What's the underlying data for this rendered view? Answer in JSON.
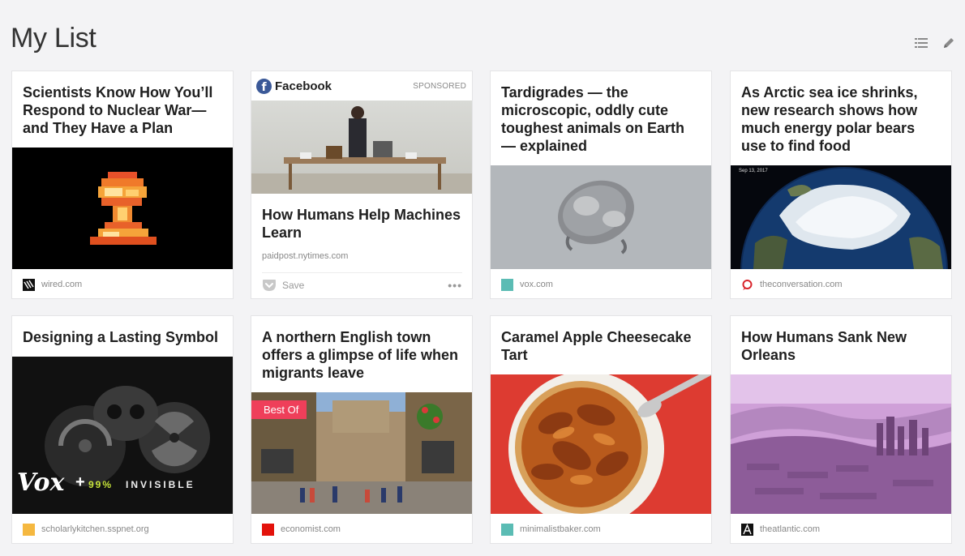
{
  "header": {
    "title": "My List"
  },
  "toolbar": {
    "list_view_icon": "list-icon",
    "edit_icon": "pencil-icon"
  },
  "cards": [
    {
      "title": "Scientists Know How You’ll Respond to Nuclear War—and They Have a Plan",
      "source": "wired.com"
    },
    {
      "ad_brand": "Facebook",
      "ad_label": "SPONSORED",
      "title": "How Humans Help Machines Learn",
      "source": "paidpost.nytimes.com",
      "save_label": "Save",
      "more_label": "•••"
    },
    {
      "title": "Tardigrades — the microscopic, oddly cute toughest animals on Earth — explained",
      "source": "vox.com"
    },
    {
      "title": "As Arctic sea ice shrinks, new research shows how much energy polar bears use to find food",
      "source": "theconversation.com",
      "image_caption": "Sep 13, 2017"
    },
    {
      "title": "Designing a Lasting Symbol",
      "source": "scholarlykitchen.sspnet.org",
      "image_text_brand": "Vox",
      "image_text_plus": "+",
      "image_text_99": "99%",
      "image_text_invisible": "INVISIBLE"
    },
    {
      "title": "A northern English town offers a glimpse of life when migrants leave",
      "source": "economist.com",
      "badge": "Best Of"
    },
    {
      "title": "Caramel Apple Cheesecake Tart",
      "source": "minimalistbaker.com"
    },
    {
      "title": "How Humans Sank New Orleans",
      "source": "theatlantic.com"
    }
  ],
  "colors": {
    "accent_badge": "#ef3f5a",
    "vox_favicon": "#5bbcb4",
    "scholarly_favicon": "#f5b840",
    "economist_favicon": "#e3120b",
    "facebook": "#3b5998"
  }
}
